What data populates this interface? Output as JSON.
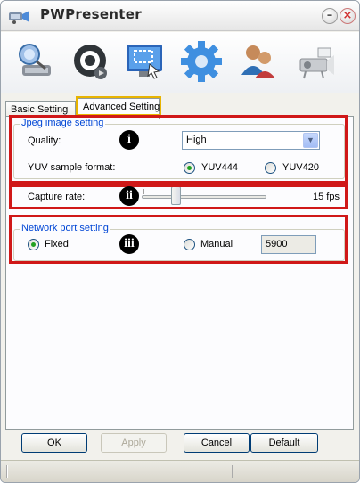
{
  "window": {
    "title": "PWPresenter"
  },
  "toolbar": {
    "icons": [
      "network-icon",
      "camera-icon",
      "screen-capture-icon",
      "settings-gear-icon",
      "users-icon",
      "projector-icon"
    ]
  },
  "tabs": [
    {
      "label": "Basic Setting",
      "active": false
    },
    {
      "label": "Advanced Setting",
      "active": true
    }
  ],
  "jpeg": {
    "legend": "Jpeg image setting",
    "quality_label": "Quality:",
    "quality_value": "High",
    "yuv_label": "YUV sample format:",
    "yuv_options": [
      "YUV444",
      "YUV420"
    ],
    "yuv_selected": "YUV444"
  },
  "capture": {
    "label": "Capture rate:",
    "value_text": "15 fps"
  },
  "network": {
    "legend": "Network port setting",
    "fixed_label": "Fixed",
    "manual_label": "Manual",
    "selected": "Fixed",
    "port_value": "5900"
  },
  "badges": [
    "i",
    "ii",
    "iii"
  ],
  "buttons": {
    "ok": "OK",
    "apply": "Apply",
    "cancel": "Cancel",
    "default": "Default"
  },
  "colors": {
    "highlight_red": "#d01818",
    "tab_highlight": "#e8b400",
    "legend_blue": "#0046d5"
  }
}
